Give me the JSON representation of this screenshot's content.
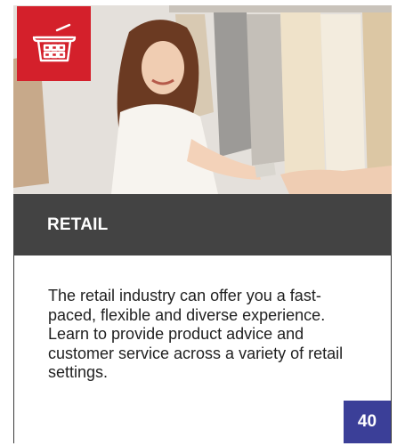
{
  "card": {
    "icon": "shopping-basket-icon",
    "title": "RETAIL",
    "description": "The retail industry can offer you a fast-paced, flexible and diverse experience. Learn to provide product advice and customer service across a variety of retail settings.",
    "page_number": "40"
  },
  "colors": {
    "badge": "#d4202b",
    "title_bar": "#434343",
    "page_badge": "#3b3f98"
  }
}
